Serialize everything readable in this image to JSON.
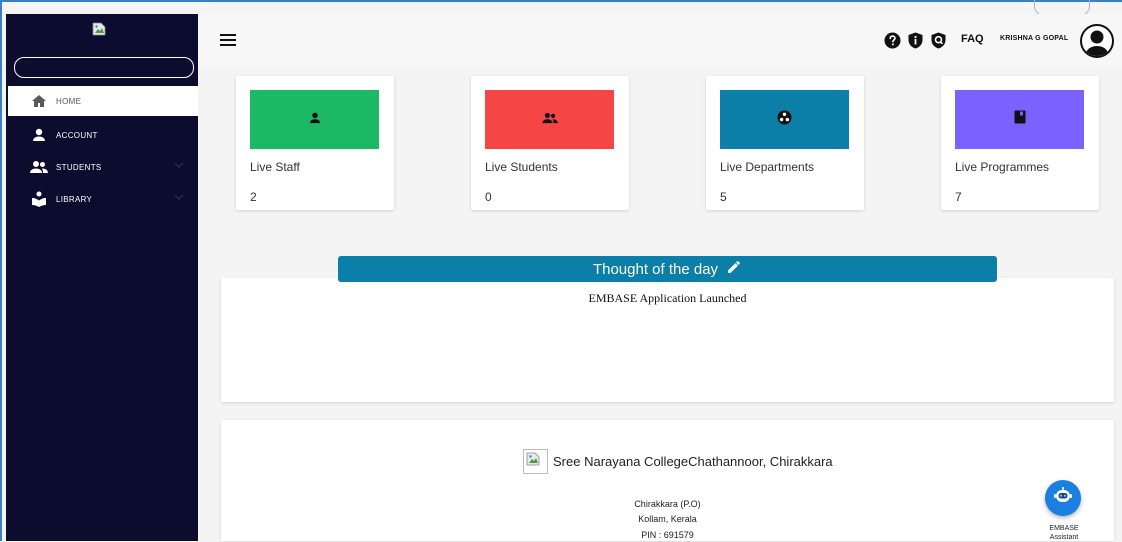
{
  "sidebar": {
    "search_placeholder": "",
    "items": [
      {
        "label": "HOME",
        "icon": "home-icon",
        "active": true
      },
      {
        "label": "ACCOUNT",
        "icon": "person-icon",
        "active": false
      },
      {
        "label": "STUDENTS",
        "icon": "group-icon",
        "active": false,
        "expandable": true
      },
      {
        "label": "LIBRARY",
        "icon": "library-icon",
        "active": false,
        "expandable": true
      }
    ]
  },
  "topbar": {
    "faq_label": "FAQ",
    "username": "KRISHNA G GOPAL",
    "icons": [
      "help-icon",
      "info-shield-icon",
      "security-shield-icon"
    ]
  },
  "cards": [
    {
      "label": "Live Staff",
      "value": "2",
      "color": "#1db866",
      "icon": "person-icon"
    },
    {
      "label": "Live Students",
      "value": "0",
      "color": "#f64545",
      "icon": "group-icon"
    },
    {
      "label": "Live Departments",
      "value": "5",
      "color": "#0b7fa8",
      "icon": "departments-icon"
    },
    {
      "label": "Live Programmes",
      "value": "7",
      "color": "#7b61ff",
      "icon": "book-icon"
    }
  ],
  "thought": {
    "title": "Thought of the day",
    "text": "EMBASE Application Launched"
  },
  "footer": {
    "college_name": "Sree Narayana CollegeChathannoor, Chirakkara",
    "address_line1": "Chirakkara (P.O)",
    "address_line2": "Kollam, Kerala",
    "address_line3": "PIN : 691579"
  },
  "assistant": {
    "label_line1": "EMBASE",
    "label_line2": "Assistant"
  },
  "colors": {
    "sidebar_bg": "#0c0c2e",
    "accent": "#0b7fa8",
    "assistant": "#1a7fe0"
  }
}
